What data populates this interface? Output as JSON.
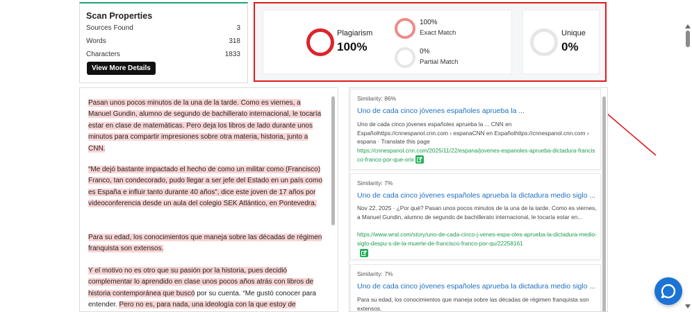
{
  "scan": {
    "title": "Scan Properties",
    "rows": [
      {
        "label": "Sources Found",
        "value": "3"
      },
      {
        "label": "Words",
        "value": "318"
      },
      {
        "label": "Characters",
        "value": "1833"
      }
    ],
    "button": "View More Details"
  },
  "results": {
    "plagiarism": {
      "label": "Plagiarism",
      "value": "100%"
    },
    "exact": {
      "value": "100%",
      "label": "Exact Match"
    },
    "partial": {
      "value": "0%",
      "label": "Partial Match"
    },
    "unique": {
      "label": "Unique",
      "value": "0%"
    },
    "colors": {
      "plagiarism": "#d9262c",
      "exact": "#f08a8a",
      "track": "#e6e6e6",
      "annotation": "#e0191b"
    }
  },
  "text": {
    "p1": "Pasan unos pocos minutos de la una de la tarde. Como es viernes, a Manuel Gundin, alumno de segundo de bachillerato internacional, le tocaría estar en clase de matemáticas. Pero deja los libros de lado durante unos minutos para compartir impresiones sobre otra materia, historia, junto a CNN.",
    "p2": "“Me dejó bastante impactado el hecho de como un militar como (Francisco) Franco, tan condecorado, pudo llegar a ser jefe del Estado en un país como es España e influir tanto durante 40 años”, dice este joven de 17 años por videoconferencia desde un aula del colegio SEK Atlántico, en Pontevedra.",
    "p3": "Para su edad, los conocimientos que maneja sobre las décadas de régimen franquista son extensos.",
    "p4a": "Y el motivo no es otro que su pasión por la historia, pues decidió complementar lo aprendido en clase unos pocos años atrás con libros de historia contemporánea que buscó",
    "p4b": " por su cuenta. “Me gustó conocer para entender. ",
    "p4c": "Pero no es, para nada, una ideología con la que estoy de"
  },
  "sources": [
    {
      "similarity": "Similarity: 86%",
      "title": "Uno de cada cinco jóvenes españoles aprueba la ...",
      "snippet": "Uno de cada cinco jóvenes españoles aprueba la ... CNN en Españolhttps://cnnespanol.cnn.com › espanaCNN en Españolhttps://cnnespanol.cnn.com › espana · Translate this page",
      "url": "https://cnnespanol.cnn.com/2025/11/22/espana/jovenes-espanoles-aprueba-dictadura-francisco-franco-por-que-orix"
    },
    {
      "similarity": "Similarity: 7%",
      "title": "Uno de cada cinco jóvenes españoles aprueba la dictadura medio siglo ...",
      "snippet": "Nov 22, 2025 · ¿Por qué? Pasan unos pocos minutos de la una de la tarde. Como es viernes, a Manuel Gundin, alumno de segundo de bachillerato internacional, le tocaría estar en...",
      "url": "https://www.wral.com/story/uno-de-cada-cinco-j-venes-espa-oles-aprueba-la-dictadura-medio-siglo-despu-s-de-la-muerte-de-francisco-franco-por-qu/22258161"
    },
    {
      "similarity": "Similarity: 7%",
      "title": "Uno de cada cinco jóvenes españoles aprueba la dictadura medio siglo ...",
      "snippet": "Para su edad, los conocimientos que maneja sobre las décadas de régimen franquista son extensos."
    }
  ]
}
